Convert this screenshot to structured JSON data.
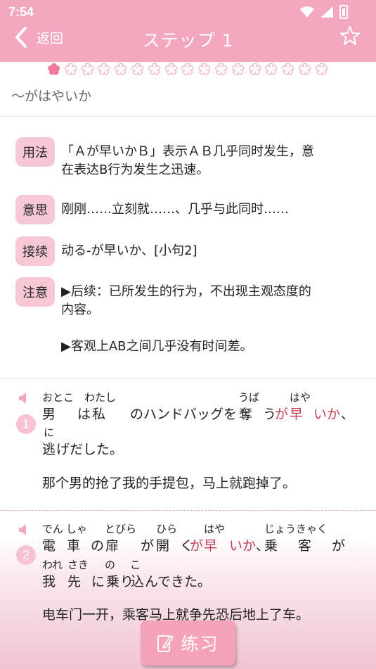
{
  "status_bar": {
    "time": "7:54"
  },
  "nav": {
    "back_label": "返回",
    "title": "ステップ 1",
    "favorite_icon": "star-outline-icon"
  },
  "progress": {
    "total": 17,
    "current": 1
  },
  "pattern": {
    "title": "～がはやいか"
  },
  "info": [
    {
      "tag": "用法",
      "lines": [
        "「Ａが早いかＢ」表示ＡＢ几乎同时发生，意",
        "在表达B行为发生之迅速。"
      ]
    },
    {
      "tag": "意思",
      "lines": [
        "刚刚……立刻就……、几乎与此同时……"
      ]
    },
    {
      "tag": "接续",
      "lines": [
        "动る-が早いか、[小句2]"
      ]
    },
    {
      "tag": "注意",
      "lines": [
        "▶后续：已所发生的行为，不出现主观态度的",
        "内容。",
        "",
        "▶客观上AB之间几乎没有时间差。"
      ]
    }
  ],
  "examples": [
    {
      "number": "1",
      "line1": {
        "segments": [
          {
            "text": "男",
            "furigana": "おとこ",
            "red": false
          },
          {
            "text": "は",
            "furigana": "",
            "red": false
          },
          {
            "text": "私",
            "furigana": "わたし",
            "red": false
          },
          {
            "text": "のハンドバッグを",
            "furigana": "",
            "red": false
          },
          {
            "text": "奪",
            "furigana": "うば",
            "red": false
          },
          {
            "text": "う",
            "furigana": "",
            "red": false
          },
          {
            "text": "が",
            "furigana": "",
            "red": true
          },
          {
            "text": "早",
            "furigana": "はや",
            "red": true
          },
          {
            "text": "いか",
            "furigana": "",
            "red": true
          },
          {
            "text": "、",
            "furigana": "",
            "red": false
          }
        ]
      },
      "line2": {
        "segments": [
          {
            "text": "逃",
            "furigana": "に",
            "red": false
          },
          {
            "text": "げだした。",
            "furigana": "",
            "red": false
          }
        ]
      },
      "translation": "那个男的抢了我的手提包，马上就跑掉了。"
    },
    {
      "number": "2",
      "line1": {
        "segments": [
          {
            "text": "電",
            "furigana": "でん",
            "red": false
          },
          {
            "text": "車",
            "furigana": "しゃ",
            "red": false
          },
          {
            "text": "の",
            "furigana": "",
            "red": false
          },
          {
            "text": "扉",
            "furigana": "とびら",
            "red": false
          },
          {
            "text": "が",
            "furigana": "",
            "red": false
          },
          {
            "text": "開",
            "furigana": "ひら",
            "red": false
          },
          {
            "text": "く",
            "furigana": "",
            "red": false
          },
          {
            "text": "が",
            "furigana": "",
            "red": true
          },
          {
            "text": "早",
            "furigana": "はや",
            "red": true
          },
          {
            "text": "いか",
            "furigana": "",
            "red": true
          },
          {
            "text": "、",
            "furigana": "",
            "red": false
          },
          {
            "text": "乗",
            "furigana": "じょう",
            "red": false
          },
          {
            "text": "客",
            "furigana": "きゃく",
            "red": false
          },
          {
            "text": "が",
            "furigana": "",
            "red": false
          }
        ]
      },
      "line2": {
        "segments": [
          {
            "text": "我",
            "furigana": "われ",
            "red": false
          },
          {
            "text": "先",
            "furigana": "さき",
            "red": false
          },
          {
            "text": "に",
            "furigana": "",
            "red": false
          },
          {
            "text": "乗",
            "furigana": "の",
            "red": false
          },
          {
            "text": "り",
            "furigana": "",
            "red": false
          },
          {
            "text": "込",
            "furigana": "こ",
            "red": false
          },
          {
            "text": "んできた。",
            "furigana": "",
            "red": false
          }
        ]
      },
      "translation": "电车门一开，乘客马上就争先恐后地上了车。"
    }
  ],
  "practice": {
    "label": "练习",
    "icon": "pencil-note-icon"
  },
  "colors": {
    "header": "#f3a7bf",
    "tag_bg": "#f6c7d4",
    "highlight_red": "#c63d55",
    "badge": "#f6c2d1"
  }
}
